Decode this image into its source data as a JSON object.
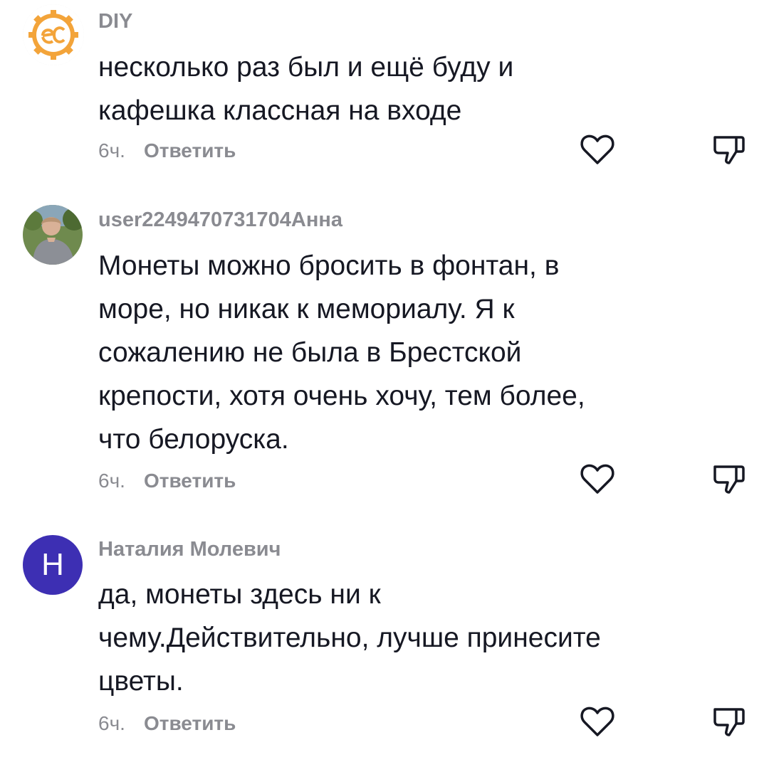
{
  "comments": [
    {
      "username": "DIY",
      "lines": [
        "несколько раз был и ещё буду и",
        "кафешка классная на входе"
      ],
      "time": "6ч.",
      "reply_label": "Ответить"
    },
    {
      "username": "user2249470731704Анна",
      "lines": [
        "Монеты можно бросить в фонтан, в",
        "море, но никак к мемориалу. Я к",
        "сожалению не была в Брестской",
        "крепости, хотя очень хочу, тем более,",
        "что белоруска."
      ],
      "time": "6ч.",
      "reply_label": "Ответить"
    },
    {
      "username": "Наталия Молевич",
      "avatar_letter": "Н",
      "lines": [
        "да, монеты здесь ни к",
        "чему.Действительно, лучше принесите",
        "цветы."
      ],
      "time": "6ч.",
      "reply_label": "Ответить"
    }
  ],
  "icons": {
    "like": "heart-outline-icon",
    "dislike": "thumbs-down-outline-icon"
  },
  "colors": {
    "text": "#161823",
    "secondary": "#8a8b91",
    "avatar_letter_bg": "#3d2fb3",
    "logo_orange": "#f3a43a"
  }
}
